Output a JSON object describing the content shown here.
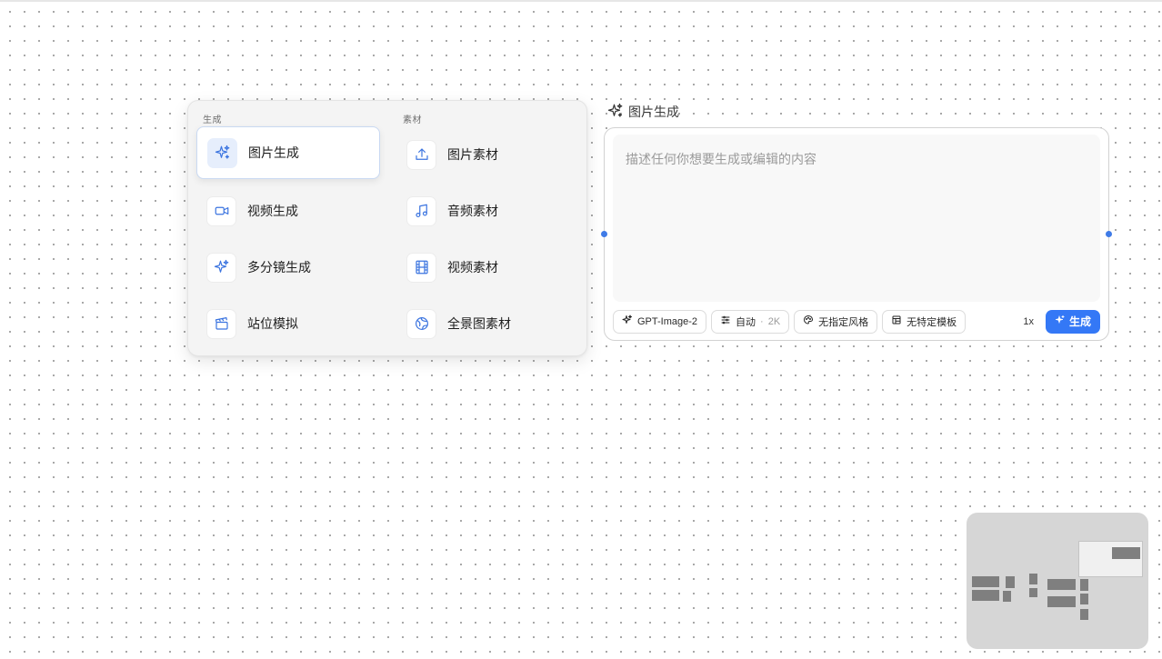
{
  "menu": {
    "generate_title": "生成",
    "assets_title": "素材",
    "generate_items": [
      {
        "label": "图片生成",
        "icon": "sparkle-icon",
        "active": true
      },
      {
        "label": "视频生成",
        "icon": "video-camera-icon"
      },
      {
        "label": "多分镜生成",
        "icon": "sparkle-icon"
      },
      {
        "label": "站位模拟",
        "icon": "clapperboard-icon"
      }
    ],
    "asset_items": [
      {
        "label": "图片素材",
        "icon": "upload-icon"
      },
      {
        "label": "音频素材",
        "icon": "music-note-icon"
      },
      {
        "label": "视频素材",
        "icon": "film-icon"
      },
      {
        "label": "全景图素材",
        "icon": "globe-icon"
      }
    ]
  },
  "node": {
    "title": "图片生成",
    "prompt_placeholder": "描述任何你想要生成或编辑的内容",
    "model": "GPT-Image-2",
    "size_mode": "自动",
    "size_separator": "·",
    "resolution": "2K",
    "style": "无指定风格",
    "template": "无特定模板",
    "count": "1x",
    "generate_label": "生成"
  },
  "colors": {
    "accent": "#3478f6",
    "icon_blue": "#3b74e0",
    "panel_bg": "#f4f4f4",
    "minimap_bg": "#d6d6d6"
  }
}
